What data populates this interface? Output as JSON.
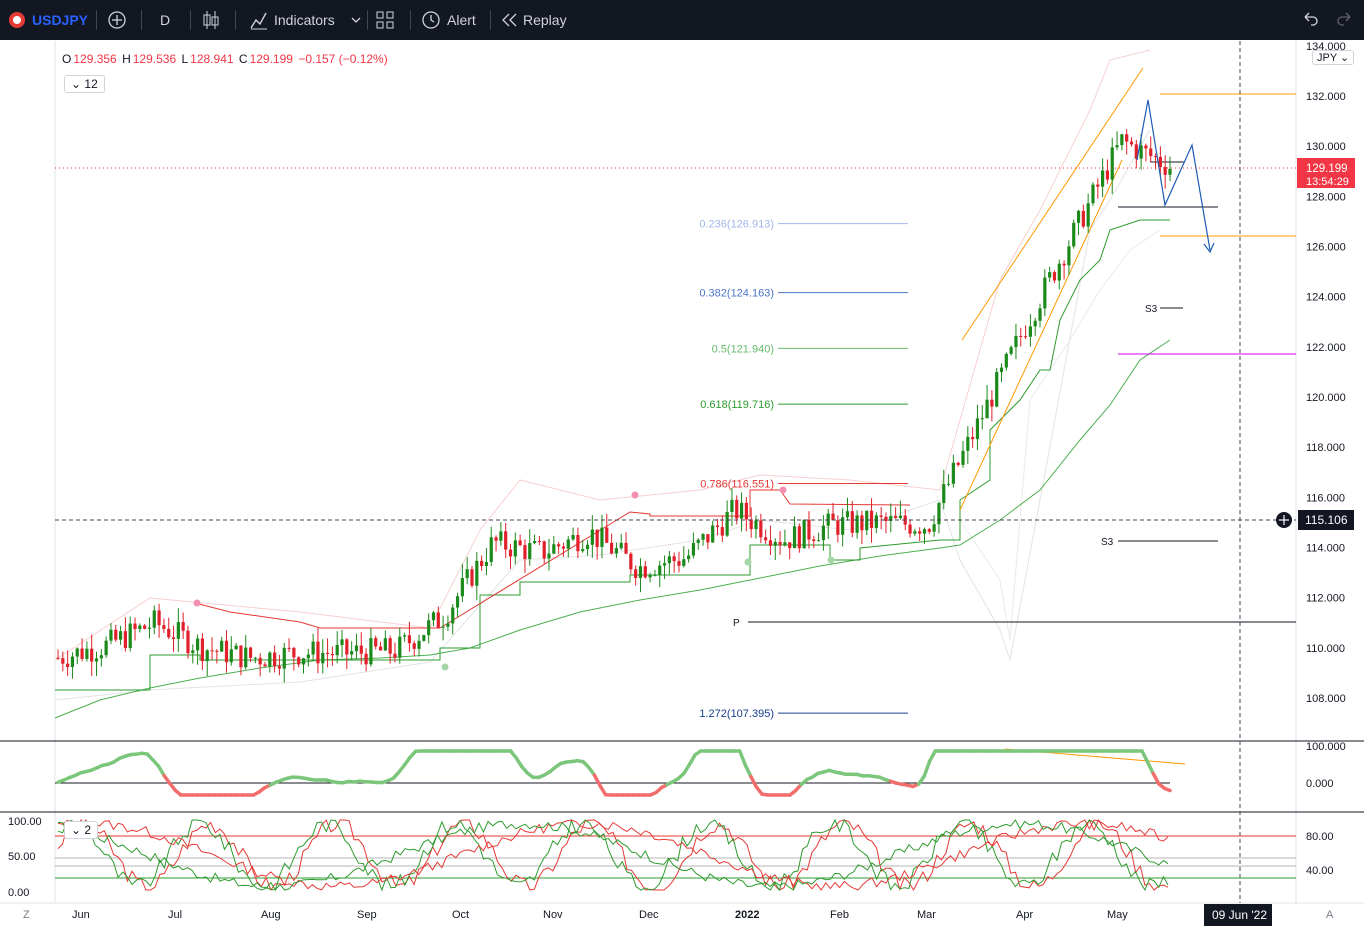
{
  "toolbar": {
    "symbol": "USDJPY",
    "interval": "D",
    "indicators_label": "Indicators",
    "alert_label": "Alert",
    "replay_label": "Replay"
  },
  "ohlc": {
    "o_label": "O",
    "o": "129.356",
    "h_label": "H",
    "h": "129.536",
    "l_label": "L",
    "l": "128.941",
    "c_label": "C",
    "c": "129.199",
    "change": "−0.157 (−0.12%)"
  },
  "legend_count": "12",
  "osc2_legend": "2",
  "currency": "JPY",
  "price_axis": {
    "labels": [
      "134.000",
      "132.000",
      "130.000",
      "128.000",
      "126.000",
      "124.000",
      "122.000",
      "120.000",
      "118.000",
      "116.000",
      "114.000",
      "112.000",
      "110.000",
      "108.000"
    ],
    "last_price": "129.199",
    "countdown": "13:54:29",
    "crosshair_price": "115.106"
  },
  "osc1_axis": {
    "labels": [
      "100.000",
      "0.000"
    ]
  },
  "osc2_axis": {
    "left_labels": [
      "100.00",
      "50.00",
      "0.00"
    ],
    "right_labels": [
      "80.00",
      "40.00"
    ]
  },
  "time_axis": {
    "labels": [
      "Jun",
      "Jul",
      "Aug",
      "Sep",
      "Oct",
      "Nov",
      "Dec",
      "2022",
      "Feb",
      "Mar",
      "Apr",
      "May"
    ],
    "crosshair_date": "09 Jun '22"
  },
  "corner_labels": {
    "left": "Z",
    "right": "A"
  },
  "fib_levels": [
    {
      "ratio": "0.236",
      "value": "126.913",
      "label": "0.236(126.913)",
      "color": "#9fb8e8"
    },
    {
      "ratio": "0.382",
      "value": "124.163",
      "label": "0.382(124.163)",
      "color": "#4c74c9"
    },
    {
      "ratio": "0.5",
      "value": "121.940",
      "label": "0.5(121.940)",
      "color": "#66bb6a"
    },
    {
      "ratio": "0.618",
      "value": "119.716",
      "label": "0.618(119.716)",
      "color": "#2e9b2e"
    },
    {
      "ratio": "0.786",
      "value": "116.551",
      "label": "0.786(116.551)",
      "color": "#e53935"
    },
    {
      "ratio": "1.272",
      "value": "107.395",
      "label": "1.272(107.395)",
      "color": "#1a3e8c"
    }
  ],
  "pivot_labels": {
    "p": "P",
    "s3_upper": "S3",
    "s3_lower": "S3"
  },
  "chart_data": {
    "type": "candlestick",
    "x": [
      "2021-06-01",
      "2021-06-15",
      "2021-07-01",
      "2021-07-15",
      "2021-08-01",
      "2021-08-15",
      "2021-09-01",
      "2021-09-15",
      "2021-10-01",
      "2021-10-15",
      "2021-11-01",
      "2021-11-15",
      "2021-12-01",
      "2021-12-15",
      "2022-01-03",
      "2022-01-17",
      "2022-02-01",
      "2022-02-15",
      "2022-03-01",
      "2022-03-15",
      "2022-04-01",
      "2022-04-15",
      "2022-05-02",
      "2022-05-16"
    ],
    "close": [
      109.6,
      110.1,
      111.0,
      110.0,
      109.6,
      109.8,
      109.8,
      109.9,
      111.3,
      114.2,
      113.8,
      114.6,
      113.2,
      113.6,
      115.5,
      114.3,
      114.9,
      115.0,
      114.9,
      118.8,
      122.8,
      126.5,
      130.2,
      129.2
    ],
    "ylim": [
      106.5,
      134.0
    ],
    "title": ""
  }
}
